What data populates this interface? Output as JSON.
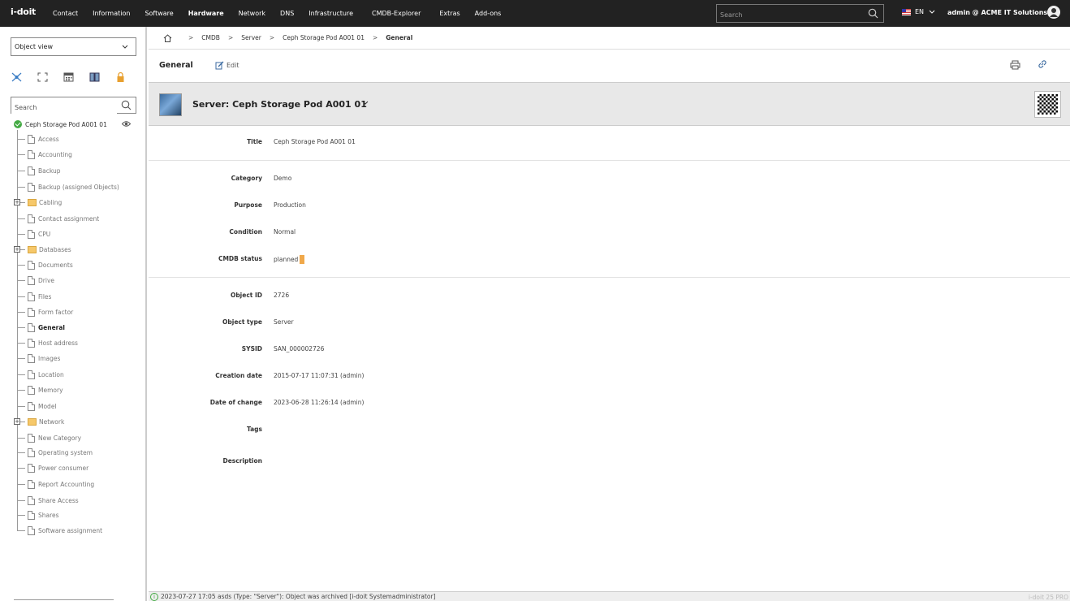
{
  "topbar": {
    "logo": "i-doit",
    "nav": [
      "Contact",
      "Information",
      "Software",
      "Hardware",
      "Network",
      "DNS",
      "Infrastructure",
      "CMDB-Explorer",
      "Extras",
      "Add-ons"
    ],
    "active_nav": "Hardware",
    "search_placeholder": "Search",
    "lang": "EN",
    "user": "admin @ ACME IT Solutions"
  },
  "sidebar": {
    "view_select": "Object view",
    "search_placeholder": "Search",
    "root": "Ceph Storage Pod A001 01",
    "items": [
      {
        "label": "Access",
        "type": "doc"
      },
      {
        "label": "Accounting",
        "type": "doc"
      },
      {
        "label": "Backup",
        "type": "doc"
      },
      {
        "label": "Backup (assigned Objects)",
        "type": "doc"
      },
      {
        "label": "Cabling",
        "type": "folder"
      },
      {
        "label": "Contact assignment",
        "type": "doc"
      },
      {
        "label": "CPU",
        "type": "doc"
      },
      {
        "label": "Databases",
        "type": "folder"
      },
      {
        "label": "Documents",
        "type": "doc"
      },
      {
        "label": "Drive",
        "type": "doc"
      },
      {
        "label": "Files",
        "type": "doc"
      },
      {
        "label": "Form factor",
        "type": "doc"
      },
      {
        "label": "General",
        "type": "doc"
      },
      {
        "label": "Host address",
        "type": "doc"
      },
      {
        "label": "Images",
        "type": "doc"
      },
      {
        "label": "Location",
        "type": "doc"
      },
      {
        "label": "Memory",
        "type": "doc"
      },
      {
        "label": "Model",
        "type": "doc"
      },
      {
        "label": "Network",
        "type": "folder"
      },
      {
        "label": "New Category",
        "type": "doc"
      },
      {
        "label": "Operating system",
        "type": "doc"
      },
      {
        "label": "Power consumer",
        "type": "doc"
      },
      {
        "label": "Report Accounting",
        "type": "doc"
      },
      {
        "label": "Share Access",
        "type": "doc"
      },
      {
        "label": "Shares",
        "type": "doc"
      },
      {
        "label": "Software assignment",
        "type": "doc"
      }
    ]
  },
  "breadcrumb": [
    "CMDB",
    "Server",
    "Ceph Storage Pod A001 01",
    "General"
  ],
  "tab": {
    "title": "General",
    "edit": "Edit"
  },
  "object": {
    "title": "Server: Ceph Storage Pod A001 01"
  },
  "form": {
    "title": {
      "label": "Title",
      "value": "Ceph Storage Pod A001 01"
    },
    "category": {
      "label": "Category",
      "value": "Demo"
    },
    "purpose": {
      "label": "Purpose",
      "value": "Production"
    },
    "condition": {
      "label": "Condition",
      "value": "Normal"
    },
    "cmdb_status": {
      "label": "CMDB status",
      "value": "planned",
      "color": "#f0a84a"
    },
    "object_id": {
      "label": "Object ID",
      "value": "2726"
    },
    "object_type": {
      "label": "Object type",
      "value": "Server"
    },
    "sysid": {
      "label": "SYSID",
      "value": "SAN_000002726"
    },
    "creation_date": {
      "label": "Creation date",
      "value": "2015-07-17 11:07:31 (admin)"
    },
    "date_of_change": {
      "label": "Date of change",
      "value": "2023-06-28 11:26:14 (admin)"
    },
    "tags": {
      "label": "Tags",
      "value": ""
    },
    "description": {
      "label": "Description",
      "value": ""
    }
  },
  "statusbar": {
    "message": "2023-07-27 17:05 asds (Type: \"Server\"): Object was archived [i-doit Systemadministrator]",
    "version": "i-doit 25 PRO"
  }
}
